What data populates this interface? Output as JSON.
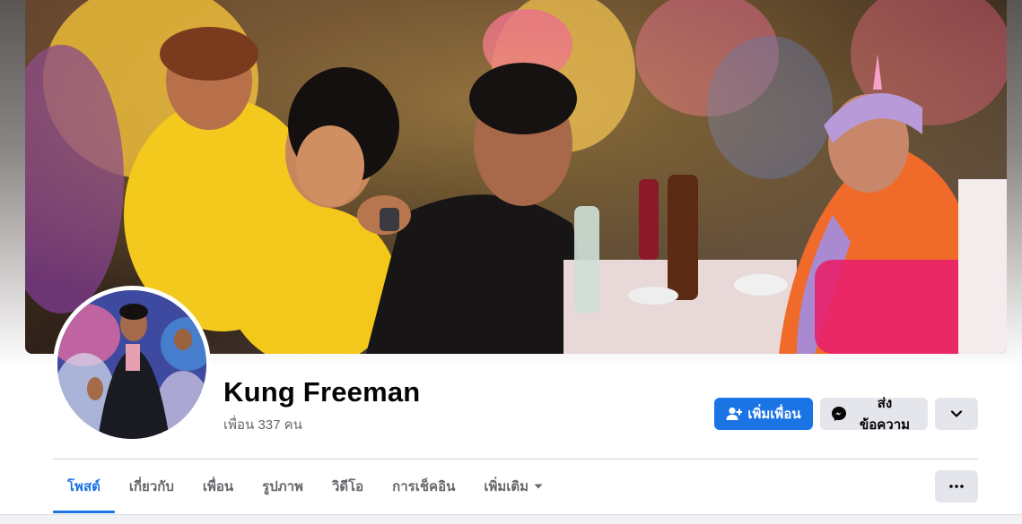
{
  "profile": {
    "name": "Kung Freeman",
    "friends_text": "เพื่อน 337 คน"
  },
  "actions": {
    "add_friend_label": "เพิ่มเพื่อน",
    "add_friend_icon": "add-friend-icon",
    "message_label": "ส่งข้อความ",
    "message_icon": "messenger-icon",
    "dropdown_icon": "chevron-down-icon",
    "more_icon": "more-dots-icon"
  },
  "tabs": [
    {
      "label": "โพสต์",
      "active": true
    },
    {
      "label": "เกี่ยวกับ",
      "active": false
    },
    {
      "label": "เพื่อน",
      "active": false
    },
    {
      "label": "รูปภาพ",
      "active": false
    },
    {
      "label": "วิดีโอ",
      "active": false
    },
    {
      "label": "การเช็คอิน",
      "active": false
    },
    {
      "label": "เพิ่มเติม",
      "active": false,
      "icon": "caret-down-icon"
    }
  ],
  "colors": {
    "accent": "#1b74e4",
    "button_secondary": "#e4e6eb",
    "muted_text": "#65676b"
  }
}
